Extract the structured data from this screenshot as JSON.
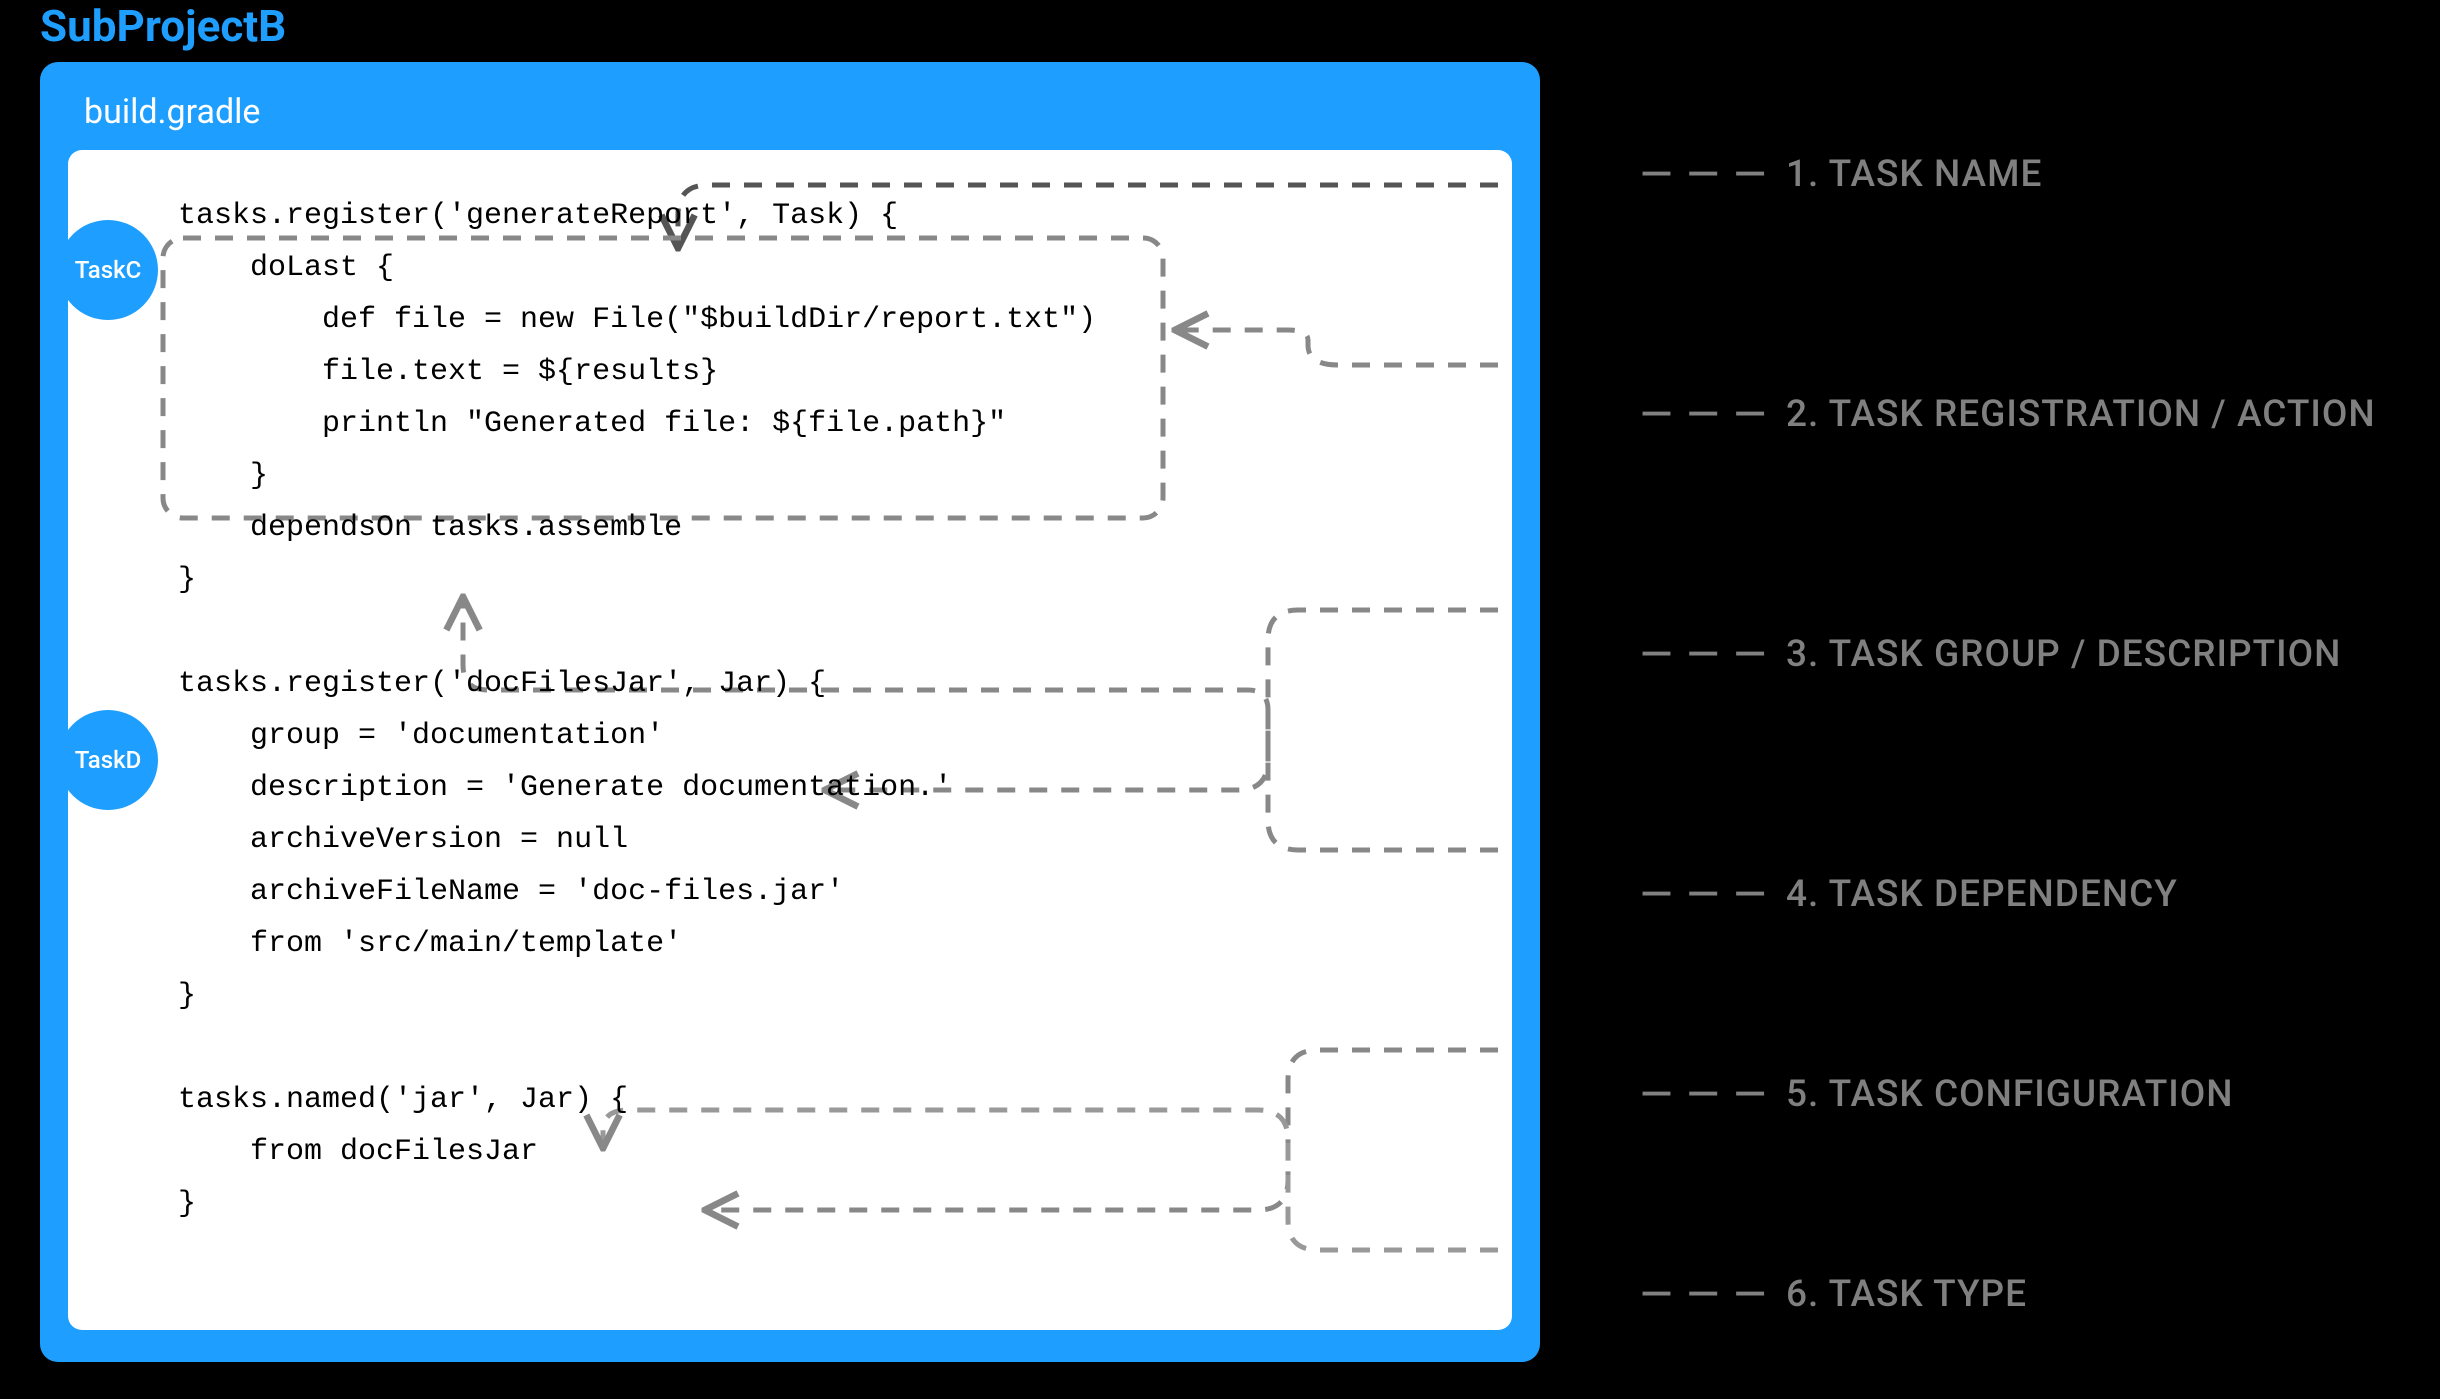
{
  "project": {
    "title": "SubProjectB"
  },
  "file": {
    "name": "build.gradle"
  },
  "tasks": {
    "c": {
      "label": "TaskC"
    },
    "d": {
      "label": "TaskD"
    }
  },
  "code": {
    "block1_l1": "tasks.register('generateReport', Task) {",
    "block1_l2": "    doLast {",
    "block1_l3": "        def file = new File(\"$buildDir/report.txt\")",
    "block1_l4": "        file.text = ${results}",
    "block1_l5": "        println \"Generated file: ${file.path}\"",
    "block1_l6": "    }",
    "block1_l7": "    dependsOn tasks.assemble",
    "block1_l8": "}",
    "block2_l1": "tasks.register('docFilesJar', Jar) {",
    "block2_l2": "    group = 'documentation'",
    "block2_l3": "    description = 'Generate documentation.'",
    "block2_l4": "    archiveVersion = null",
    "block2_l5": "    archiveFileName = 'doc-files.jar'",
    "block2_l6": "    from 'src/main/template'",
    "block2_l7": "}",
    "block3_l1": "tasks.named('jar', Jar) {",
    "block3_l2": "    from docFilesJar",
    "block3_l3": "}"
  },
  "annotations": {
    "a1": "1.  TASK NAME",
    "a2": "2.  TASK REGISTRATION / ACTION",
    "a3": "3.  TASK GROUP / DESCRIPTION",
    "a4": "4.  TASK DEPENDENCY",
    "a5": "5.  TASK CONFIGURATION",
    "a6": "6.  TASK TYPE"
  },
  "dash_leader": "— — —"
}
